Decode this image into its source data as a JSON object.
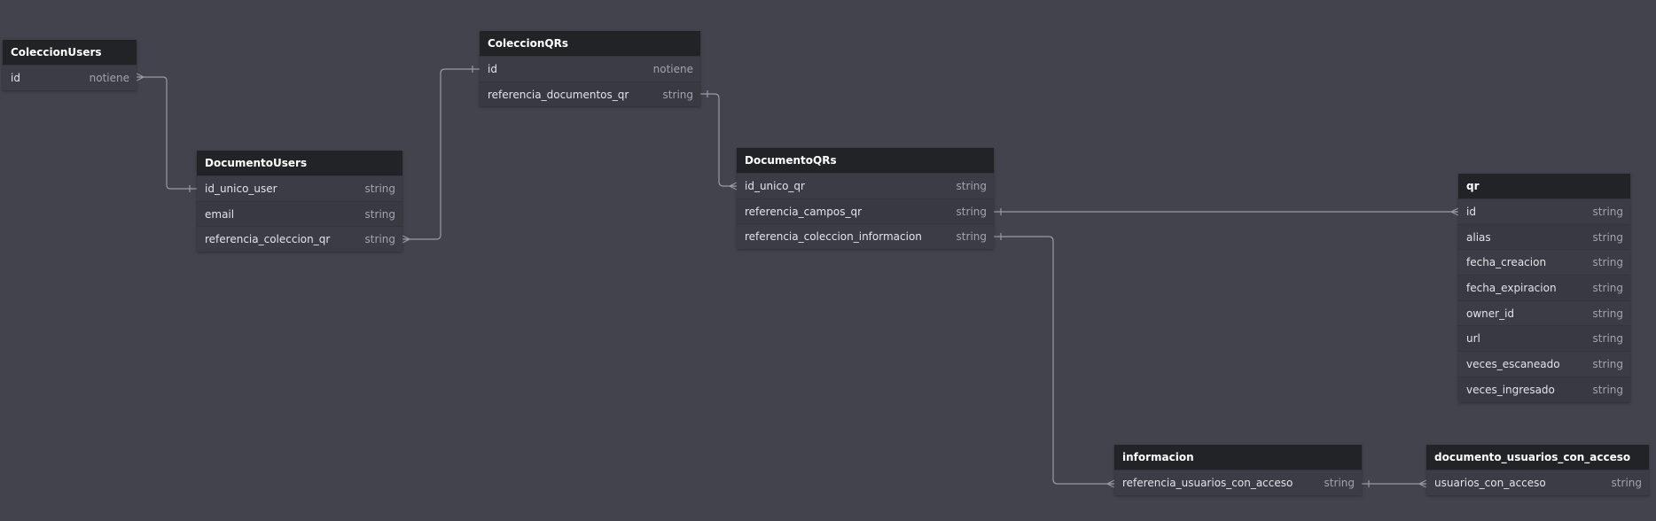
{
  "diagram": {
    "colors": {
      "background": "#43434d",
      "table_header": "#222326",
      "table_body": "#3a3a43",
      "relation_line": "#9a9aa5"
    },
    "tables": {
      "coleccionusers": {
        "name": "ColeccionUsers",
        "fields": [
          {
            "name": "id",
            "type": "notiene"
          }
        ]
      },
      "documentousers": {
        "name": "DocumentoUsers",
        "fields": [
          {
            "name": "id_unico_user",
            "type": "string"
          },
          {
            "name": "email",
            "type": "string"
          },
          {
            "name": "referencia_coleccion_qr",
            "type": "string"
          }
        ]
      },
      "coleccionqrs": {
        "name": "ColeccionQRs",
        "fields": [
          {
            "name": "id",
            "type": "notiene"
          },
          {
            "name": "referencia_documentos_qr",
            "type": "string"
          }
        ]
      },
      "documentoqrs": {
        "name": "DocumentoQRs",
        "fields": [
          {
            "name": "id_unico_qr",
            "type": "string"
          },
          {
            "name": "referencia_campos_qr",
            "type": "string"
          },
          {
            "name": "referencia_coleccion_informacion",
            "type": "string"
          }
        ]
      },
      "qr": {
        "name": "qr",
        "fields": [
          {
            "name": "id",
            "type": "string"
          },
          {
            "name": "alias",
            "type": "string"
          },
          {
            "name": "fecha_creacion",
            "type": "string"
          },
          {
            "name": "fecha_expiracion",
            "type": "string"
          },
          {
            "name": "owner_id",
            "type": "string"
          },
          {
            "name": "url",
            "type": "string"
          },
          {
            "name": "veces_escaneado",
            "type": "string"
          },
          {
            "name": "veces_ingresado",
            "type": "string"
          }
        ]
      },
      "informacion": {
        "name": "informacion",
        "fields": [
          {
            "name": "referencia_usuarios_con_acceso",
            "type": "string"
          }
        ]
      },
      "documento_usuarios": {
        "name": "documento_usuarios_con_acceso",
        "fields": [
          {
            "name": "usuarios_con_acceso",
            "type": "string"
          }
        ]
      }
    },
    "relations": [
      {
        "from": "ColeccionUsers.id",
        "to": "DocumentoUsers.id_unico_user",
        "from_end": "many",
        "to_end": "one"
      },
      {
        "from": "DocumentoUsers.referencia_coleccion_qr",
        "to": "ColeccionQRs.id",
        "from_end": "many",
        "to_end": "one"
      },
      {
        "from": "ColeccionQRs.referencia_documentos_qr",
        "to": "DocumentoQRs.id_unico_qr",
        "from_end": "one",
        "to_end": "many"
      },
      {
        "from": "DocumentoQRs.referencia_campos_qr",
        "to": "qr.id",
        "from_end": "one",
        "to_end": "many"
      },
      {
        "from": "DocumentoQRs.referencia_coleccion_informacion",
        "to": "informacion.referencia_usuarios_con_acceso",
        "from_end": "one",
        "to_end": "many"
      },
      {
        "from": "informacion.referencia_usuarios_con_acceso",
        "to": "documento_usuarios_con_acceso.usuarios_con_acceso",
        "from_end": "one",
        "to_end": "many"
      }
    ]
  }
}
